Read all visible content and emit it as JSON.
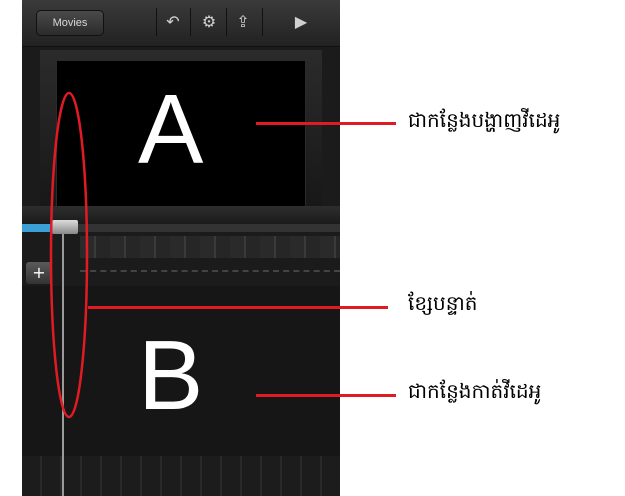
{
  "toolbar": {
    "movies_label": "Movies",
    "icons": [
      "undo-icon",
      "gear-icon",
      "export-icon",
      "play-icon"
    ]
  },
  "markers": {
    "a": "A",
    "b": "B"
  },
  "annotations": {
    "video_display_area": "ជាកន្លែងបង្ហាញវីដេអូ",
    "timeline_line": "ខ្សែបន្ទាត់",
    "video_cutting_area": "ជាកន្លែងកាត់វីដេអូ"
  },
  "colors": {
    "annotation_red": "#e01b24",
    "app_background": "#1b1b1b",
    "progress_accent": "#3aa0d6"
  }
}
